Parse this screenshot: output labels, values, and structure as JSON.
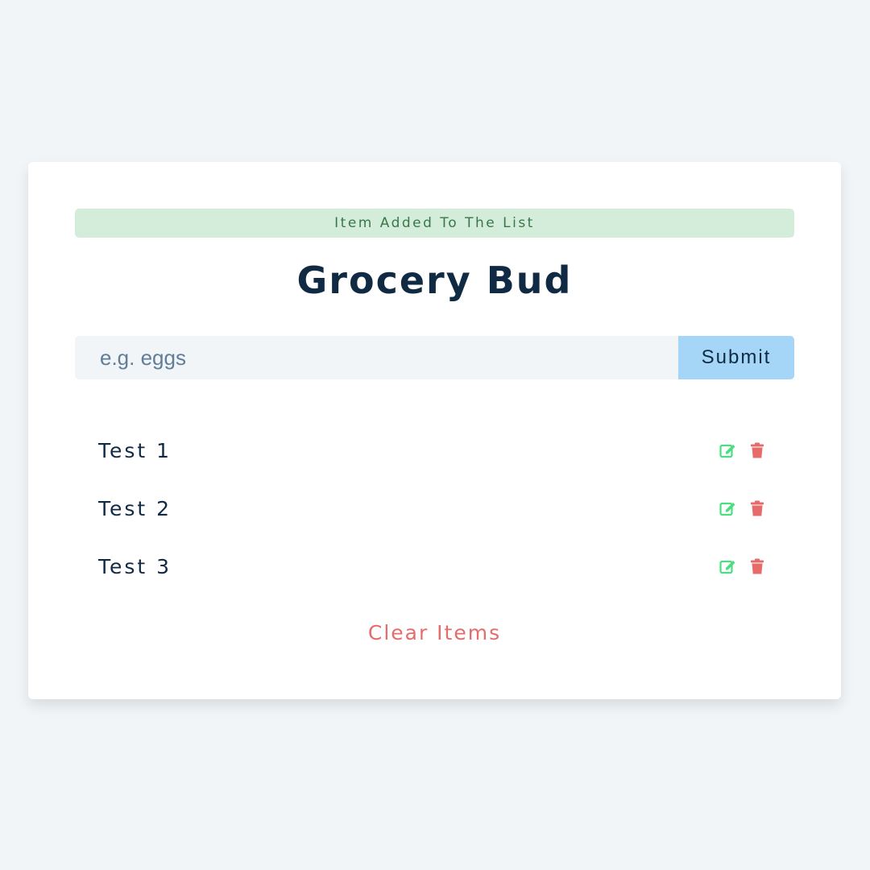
{
  "alert": {
    "text": "Item Added To The List",
    "type": "success"
  },
  "header": {
    "title": "Grocery Bud"
  },
  "form": {
    "placeholder": "e.g. eggs",
    "value": "",
    "submit_label": "Submit"
  },
  "list": {
    "items": [
      {
        "title": "Test 1"
      },
      {
        "title": "Test 2"
      },
      {
        "title": "Test 3"
      }
    ],
    "edit_icon": "edit-icon",
    "delete_icon": "trash-icon"
  },
  "clear": {
    "label": "Clear Items"
  },
  "colors": {
    "background": "#f1f5f8",
    "card": "#ffffff",
    "alert_bg": "#d4eddb",
    "alert_text": "#39764a",
    "title": "#102a43",
    "input_bg": "#f1f5f8",
    "button_bg": "#a5d6f7",
    "edit": "#4ade80",
    "delete": "#e66b6b",
    "clear": "#e66b6b"
  }
}
